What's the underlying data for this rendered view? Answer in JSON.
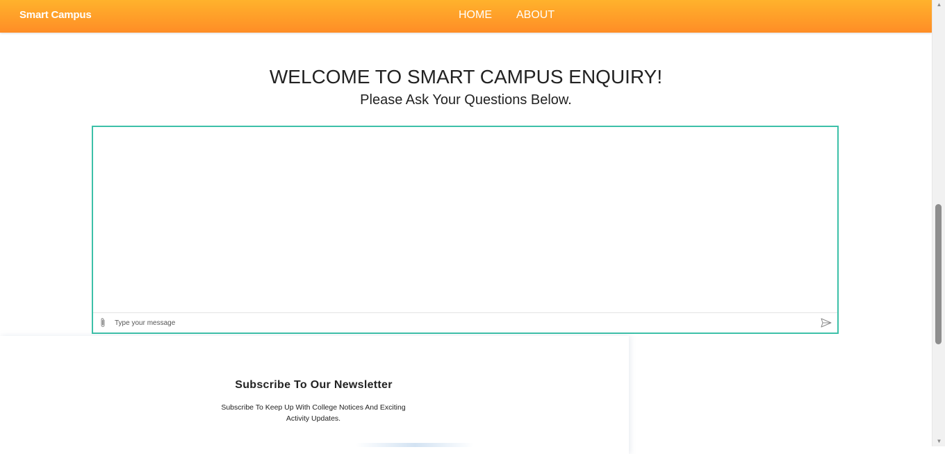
{
  "navbar": {
    "brand": "Smart Campus",
    "links": [
      {
        "label": "HOME"
      },
      {
        "label": "ABOUT"
      }
    ],
    "gradient_top": "#ffb22c",
    "gradient_bottom": "#ff8d26"
  },
  "main": {
    "title": "WELCOME TO SMART CAMPUS ENQUIRY!",
    "subtitle": "Please Ask Your Questions Below."
  },
  "chat": {
    "border_color": "#3cc0a8",
    "input_placeholder": "Type your message",
    "input_value": "",
    "attach_icon": "paperclip-icon",
    "send_icon": "send-icon"
  },
  "newsletter": {
    "title": "Subscribe To Our Newsletter",
    "text": "Subscribe To Keep Up With College Notices And Exciting Activity Updates."
  }
}
